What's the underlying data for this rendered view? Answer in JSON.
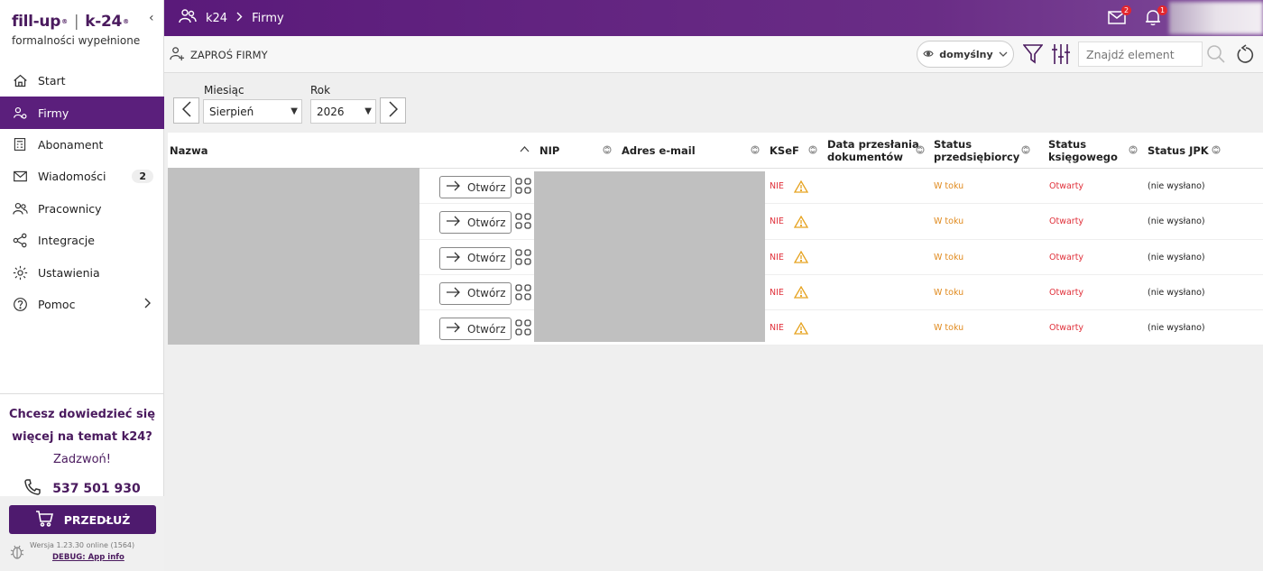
{
  "sidebar": {
    "brand_left": "fill-up",
    "brand_right": "k-24",
    "tagline": "formalności wypełnione",
    "items": [
      {
        "label": "Start",
        "icon": "home-icon"
      },
      {
        "label": "Firmy",
        "icon": "users-gear-icon",
        "active": true
      },
      {
        "label": "Abonament",
        "icon": "calculator-icon"
      },
      {
        "label": "Wiadomości",
        "icon": "mail-icon",
        "badge": "2"
      },
      {
        "label": "Pracownicy",
        "icon": "people-icon"
      },
      {
        "label": "Integracje",
        "icon": "share-icon"
      },
      {
        "label": "Ustawienia",
        "icon": "gear-icon"
      },
      {
        "label": "Pomoc",
        "icon": "help-icon",
        "chevron": true
      }
    ],
    "promo_line1": "Chcesz dowiedzieć się",
    "promo_line2": "więcej na temat k24?",
    "promo_line3": "Zadzwoń!",
    "phone": "537 501 930",
    "extend_label": "PRZEDŁUŻ",
    "version": "Wersja 1.23.30 online (1564)",
    "debug": "DEBUG: App info"
  },
  "topbar": {
    "crumb_root": "k24",
    "crumb_current": "Firmy",
    "mail_count": "2",
    "bell_count": "1"
  },
  "toolbar": {
    "invite_label": "ZAPROŚ FIRMY",
    "view_label": "domyślny",
    "search_placeholder": "Znajdź element"
  },
  "filters": {
    "month_label": "Miesiąc",
    "month_value": "Sierpień",
    "year_label": "Rok",
    "year_value": "2026"
  },
  "table": {
    "headers": {
      "name": "Nazwa",
      "nip": "NIP",
      "email": "Adres e-mail",
      "ksef": "KSeF",
      "data1": "Data przesłania",
      "data2": "dokumentów",
      "sp1": "Status",
      "sp2": "przedsiębiorcy",
      "sk1": "Status",
      "sk2": "księgowego",
      "jpk": "Status JPK"
    },
    "open_label": "Otwórz",
    "rows": [
      {
        "ksef": "NIE",
        "status_p": "W toku",
        "status_k": "Otwarty",
        "jpk": "(nie wysłano)"
      },
      {
        "ksef": "NIE",
        "status_p": "W toku",
        "status_k": "Otwarty",
        "jpk": "(nie wysłano)"
      },
      {
        "ksef": "NIE",
        "status_p": "W toku",
        "status_k": "Otwarty",
        "jpk": "(nie wysłano)"
      },
      {
        "ksef": "NIE",
        "status_p": "W toku",
        "status_k": "Otwarty",
        "jpk": "(nie wysłano)"
      },
      {
        "ksef": "NIE",
        "status_p": "W toku",
        "status_k": "Otwarty",
        "jpk": "(nie wysłano)"
      }
    ]
  },
  "colors": {
    "brand": "#5b1f7c",
    "danger": "#e0303a",
    "warning": "#e08a1e"
  }
}
